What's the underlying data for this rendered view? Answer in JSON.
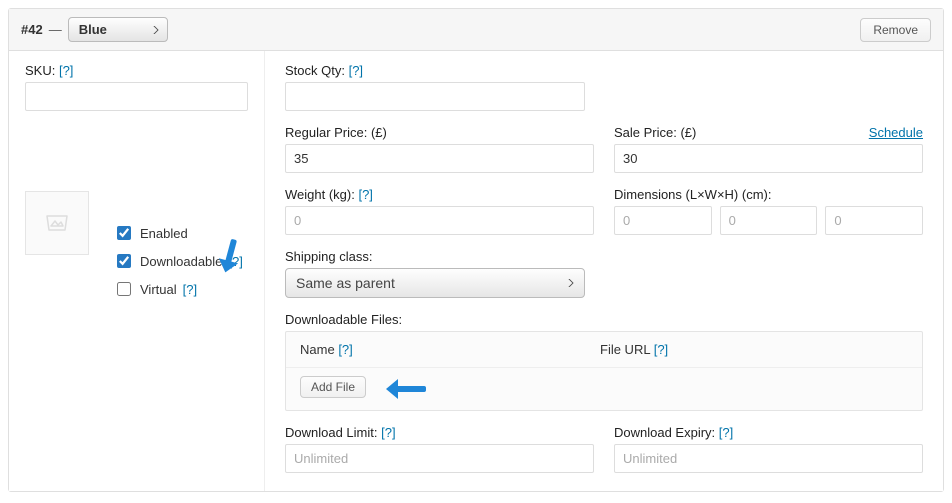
{
  "header": {
    "id_prefix": "#42",
    "dash": "—",
    "attribute_options": [
      "Blue"
    ],
    "attribute_selected": "Blue",
    "remove_label": "Remove"
  },
  "left": {
    "sku_label": "SKU:",
    "sku_value": "",
    "enabled_label": "Enabled",
    "enabled_checked": true,
    "downloadable_label": "Downloadable",
    "downloadable_checked": true,
    "virtual_label": "Virtual",
    "virtual_checked": false
  },
  "right": {
    "stock_label": "Stock Qty:",
    "stock_value": "",
    "regular_label": "Regular Price: (£)",
    "regular_value": "35",
    "sale_label": "Sale Price: (£)",
    "sale_value": "30",
    "schedule_label": "Schedule",
    "weight_label": "Weight (kg):",
    "weight_placeholder": "0",
    "dimensions_label": "Dimensions (L×W×H) (cm):",
    "dim_l_placeholder": "0",
    "dim_w_placeholder": "0",
    "dim_h_placeholder": "0",
    "shipping_label": "Shipping class:",
    "shipping_options": [
      "Same as parent"
    ],
    "shipping_selected": "Same as parent",
    "files_label": "Downloadable Files:",
    "files_col_name": "Name",
    "files_col_url": "File URL",
    "add_file_label": "Add File",
    "download_limit_label": "Download Limit:",
    "download_limit_placeholder": "Unlimited",
    "download_expiry_label": "Download Expiry:",
    "download_expiry_placeholder": "Unlimited"
  },
  "help": {
    "q": "[?]"
  }
}
